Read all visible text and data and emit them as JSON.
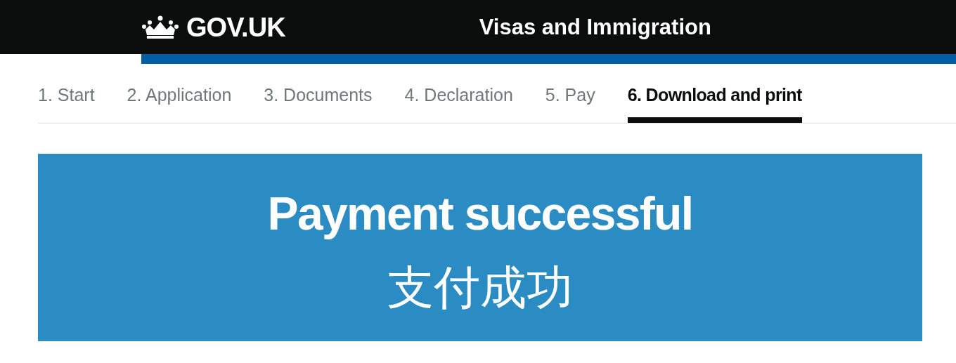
{
  "header": {
    "logo": "GOV.UK",
    "service": "Visas and Immigration"
  },
  "steps": [
    {
      "label": "1. Start",
      "selected": false
    },
    {
      "label": "2. Application",
      "selected": false
    },
    {
      "label": "3. Documents",
      "selected": false
    },
    {
      "label": "4. Declaration",
      "selected": false
    },
    {
      "label": "5. Pay",
      "selected": false
    },
    {
      "label": "6. Download and print",
      "selected": true
    }
  ],
  "panel": {
    "title": "Payment successful",
    "subtitle": "支付成功"
  }
}
